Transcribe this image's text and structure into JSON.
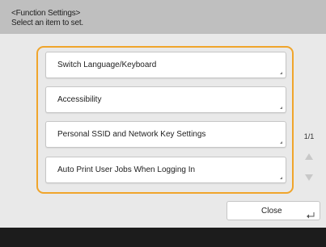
{
  "header": {
    "title": "<Function Settings>",
    "instruction": "Select an item to set."
  },
  "items": [
    {
      "label": "Switch Language/Keyboard"
    },
    {
      "label": "Accessibility"
    },
    {
      "label": "Personal SSID and Network Key Settings"
    },
    {
      "label": "Auto Print User Jobs When Logging In"
    }
  ],
  "pager": {
    "page": "1/1"
  },
  "close_button": {
    "label": "Close"
  },
  "colors": {
    "accent": "#f0a52c",
    "header_bg": "#bfbfbf",
    "footer_bg": "#1c1c1c"
  },
  "icons": {
    "scroll_up": "triangle-up-icon",
    "scroll_down": "triangle-down-icon",
    "item_caret": "corner-caret-icon",
    "enter": "enter-arrow-icon"
  }
}
